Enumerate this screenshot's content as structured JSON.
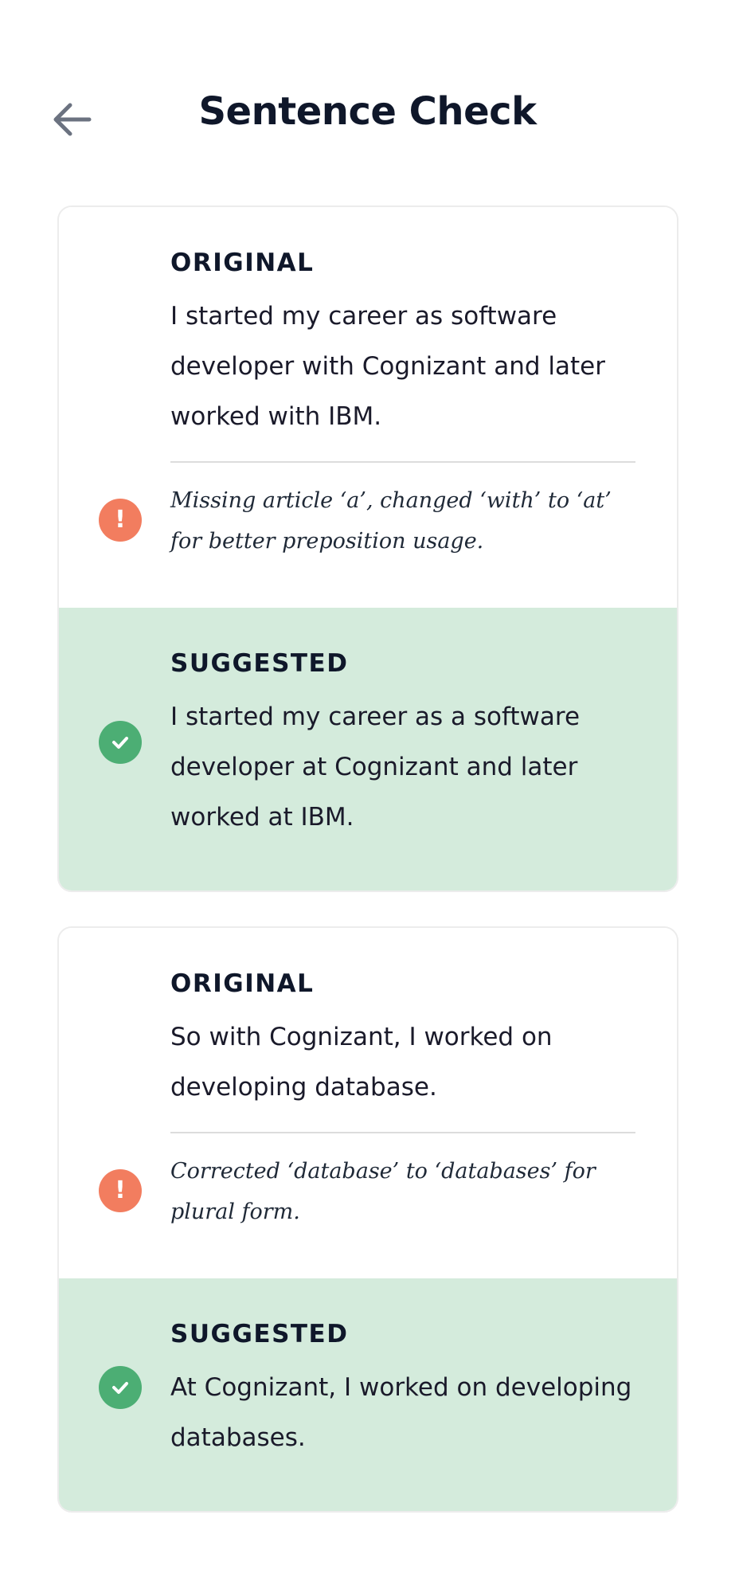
{
  "header": {
    "title": "Sentence Check",
    "back_icon": "arrow-left-icon"
  },
  "colors": {
    "warning": "#f27d5f",
    "success": "#4cae74",
    "suggested_bg": "#d4ebdc"
  },
  "checks": [
    {
      "original_label": "ORIGINAL",
      "original_text": "I started my career as software developer with Cognizant and later worked with IBM.",
      "note": "Missing article ‘a’, changed ‘with’ to ‘at’ for better preposition usage.",
      "suggested_label": "SUGGESTED",
      "suggested_text": "I started my career as a software developer at Cognizant and later worked at IBM."
    },
    {
      "original_label": "ORIGINAL",
      "original_text": "So with Cognizant, I worked on developing database.",
      "note": "Corrected ‘database’ to ‘databases’ for plural form.",
      "suggested_label": "SUGGESTED",
      "suggested_text": "At Cognizant, I worked on developing databases."
    }
  ]
}
